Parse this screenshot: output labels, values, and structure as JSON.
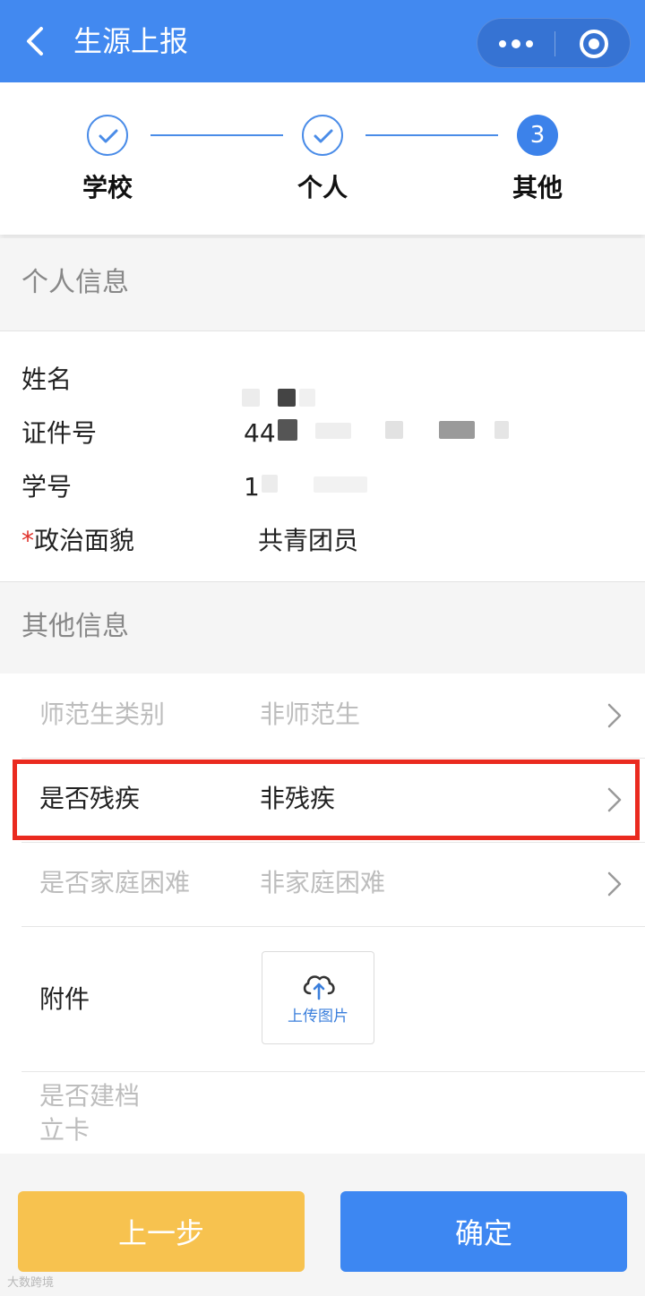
{
  "header": {
    "title": "生源上报"
  },
  "stepper": {
    "steps": [
      {
        "label": "学校",
        "status": "done"
      },
      {
        "label": "个人",
        "status": "done"
      },
      {
        "label": "其他",
        "status": "active",
        "number": "3"
      }
    ]
  },
  "personal_section": {
    "title": "个人信息",
    "rows": [
      {
        "label": "姓名",
        "value": ""
      },
      {
        "label": "证件号",
        "value": "44"
      },
      {
        "label": "学号",
        "value": "1"
      },
      {
        "label": "政治面貌",
        "required": true,
        "value": "共青团员"
      }
    ]
  },
  "other_section": {
    "title": "其他信息",
    "rows": [
      {
        "label": "师范生类别",
        "value": "非师范生"
      },
      {
        "label": "是否残疾",
        "value": "非残疾"
      },
      {
        "label": "是否家庭困难",
        "value": "非家庭困难"
      }
    ],
    "attachment": {
      "label": "附件",
      "upload_label": "上传图片"
    },
    "archive": {
      "label_line1": "是否建档",
      "label_line2": "立卡"
    }
  },
  "footer": {
    "prev_label": "上一步",
    "confirm_label": "确定"
  },
  "watermark": "大数跨境",
  "colors": {
    "header_bg": "#4289f0",
    "accent": "#3c82ea",
    "prev_button": "#f7c24f",
    "confirm_button": "#3d87f2",
    "highlight": "#ea2a1f",
    "required": "#e0322b"
  }
}
